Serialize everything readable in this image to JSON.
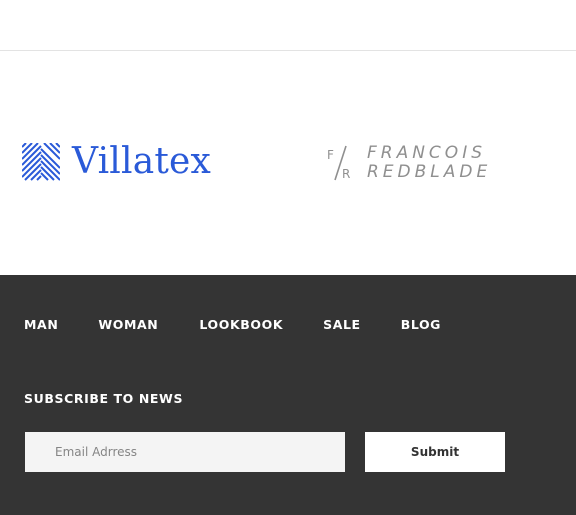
{
  "brands": {
    "villatex": {
      "name": "Villatex",
      "color": "#2a5ad8"
    },
    "francois": {
      "monogram_top": "F",
      "monogram_bottom": "R",
      "line1": "FRANCOIS",
      "line2": "REDBLADE",
      "color": "#8f8f8f"
    }
  },
  "footer": {
    "background": "#343434",
    "nav": [
      "MAN",
      "WOMAN",
      "LOOKBOOK",
      "SALE",
      "BLOG"
    ],
    "subscribe": {
      "heading": "SUBSCRIBE TO NEWS",
      "email_placeholder": "Email Adrress",
      "submit_label": "Submit"
    }
  }
}
